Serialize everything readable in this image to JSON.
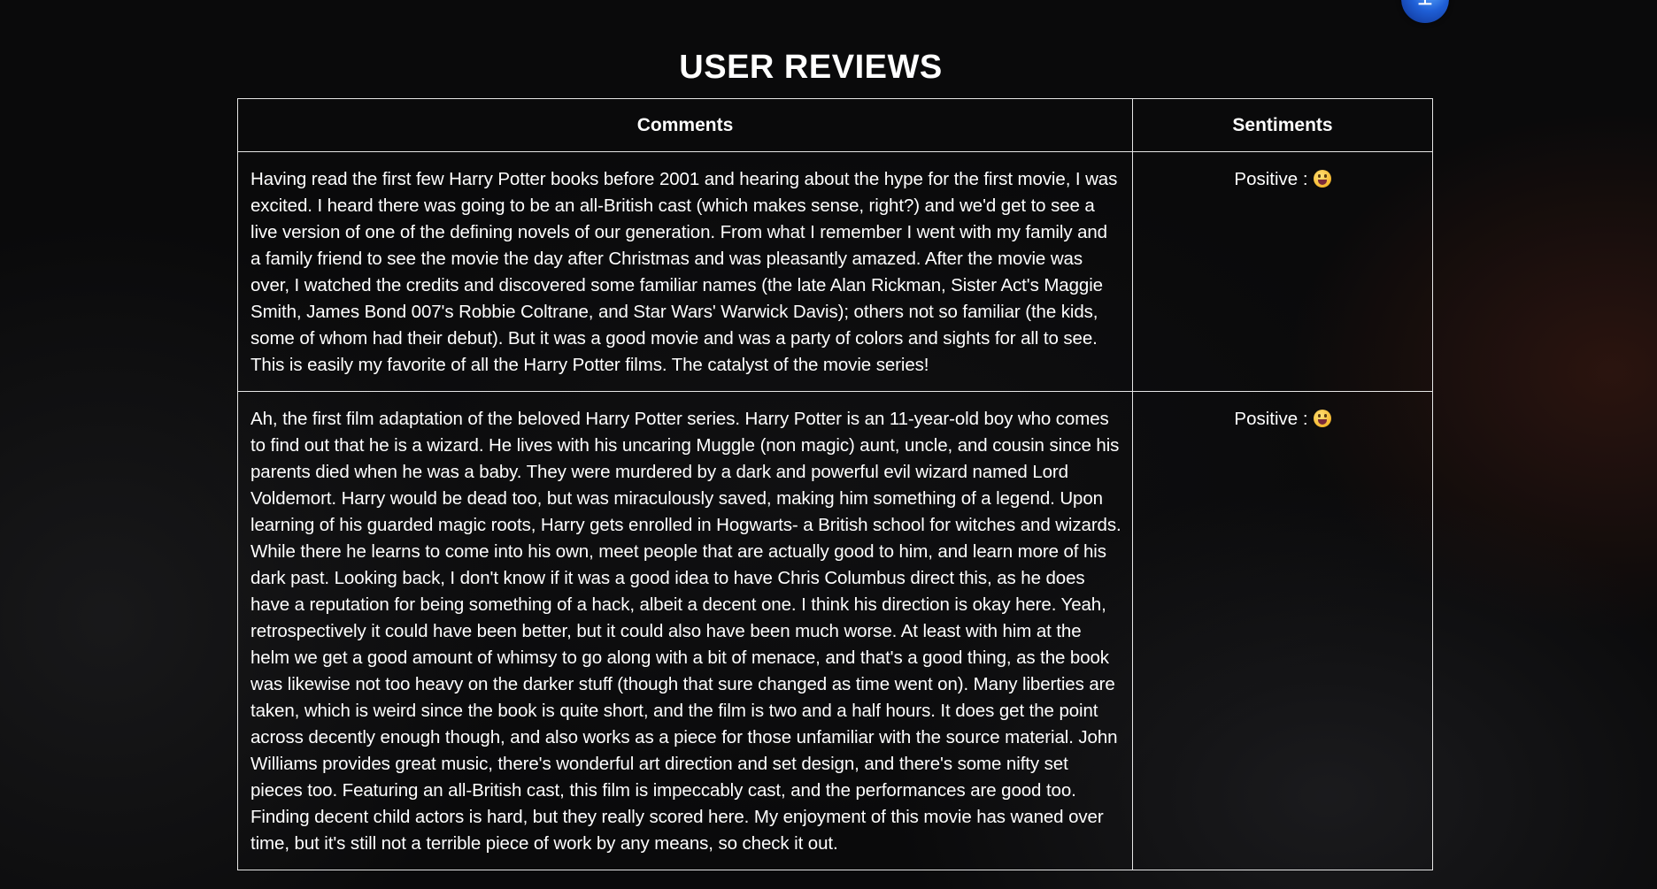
{
  "page": {
    "title": "USER REVIEWS"
  },
  "table": {
    "headers": {
      "comments": "Comments",
      "sentiments": "Sentiments"
    },
    "rows": [
      {
        "comment": "Having read the first few Harry Potter books before 2001 and hearing about the hype for the first movie, I was excited. I heard there was going to be an all-British cast (which makes sense, right?) and we'd get to see a live version of one of the defining novels of our generation. From what I remember I went with my family and a family friend to see the movie the day after Christmas and was pleasantly amazed. After the movie was over, I watched the credits and discovered some familiar names (the late Alan Rickman, Sister Act's Maggie Smith, James Bond 007's Robbie Coltrane, and Star Wars' Warwick Davis); others not so familiar (the kids, some of whom had their debut). But it was a good movie and was a party of colors and sights for all to see. This is easily my favorite of all the Harry Potter films. The catalyst of the movie series!",
        "sentiment": "Positive :",
        "sentiment_icon": "grinning-face-emoji"
      },
      {
        "comment": "Ah, the first film adaptation of the beloved Harry Potter series. Harry Potter is an 11-year-old boy who comes to find out that he is a wizard. He lives with his uncaring Muggle (non magic) aunt, uncle, and cousin since his parents died when he was a baby. They were murdered by a dark and powerful evil wizard named Lord Voldemort. Harry would be dead too, but was miraculously saved, making him something of a legend. Upon learning of his guarded magic roots, Harry gets enrolled in Hogwarts- a British school for witches and wizards. While there he learns to come into his own, meet people that are actually good to him, and learn more of his dark past. Looking back, I don't know if it was a good idea to have Chris Columbus direct this, as he does have a reputation for being something of a hack, albeit a decent one. I think his direction is okay here. Yeah, retrospectively it could have been better, but it could also have been much worse. At least with him at the helm we get a good amount of whimsy to go along with a bit of menace, and that's a good thing, as the book was likewise not too heavy on the darker stuff (though that sure changed as time went on). Many liberties are taken, which is weird since the book is quite short, and the film is two and a half hours. It does get the point across decently enough though, and also works as a piece for those unfamiliar with the source material. John Williams provides great music, there's wonderful art direction and set design, and there's some nifty set pieces too. Featuring an all-British cast, this film is impeccably cast, and the performances are good too. Finding decent child actors is hard, but they really scored here. My enjoyment of this movie has waned over time, but it's still not a terrible piece of work by any means, so check it out.",
        "sentiment": "Positive :",
        "sentiment_icon": "grinning-face-emoji"
      }
    ]
  },
  "corner_badge": {
    "icon": "accessibility-badge-icon"
  }
}
